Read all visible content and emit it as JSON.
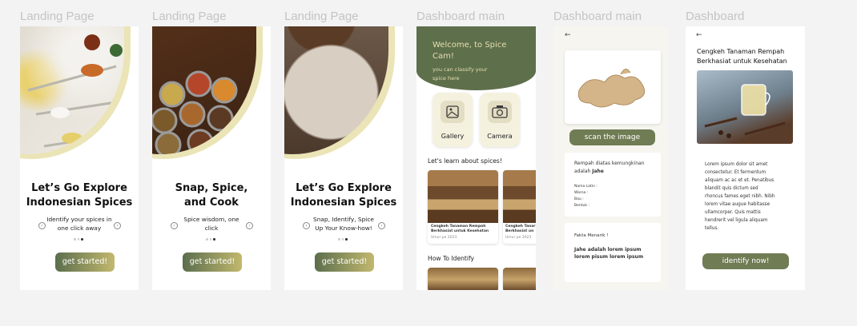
{
  "frame_labels": [
    "Landing Page",
    "Landing Page",
    "Landing Page",
    "Dashboard main",
    "Dashboard main",
    "Dashboard"
  ],
  "landing": [
    {
      "title_line1": "Let’s Go Explore",
      "title_line2": "Indonesian Spices",
      "subtitle_line1": "Identify your spices in",
      "subtitle_line2": "one click away",
      "button": "get started!"
    },
    {
      "title_line1": "Snap, Spice,",
      "title_line2": "and Cook",
      "subtitle_line1": "Spice wisdom, one",
      "subtitle_line2": "click",
      "button": "get started!"
    },
    {
      "title_line1": "Let’s Go Explore",
      "title_line2": "Indonesian Spices",
      "subtitle_line1": "Snap, Identify, Spice",
      "subtitle_line2": "Up Your Know-how!",
      "button": "get started!"
    }
  ],
  "dashboard": {
    "welcome_line1": "Welcome, to Spice",
    "welcome_line2": "Cam!",
    "sub_line1": "you can classify your",
    "sub_line2": "spice here",
    "gallery": "Gallery",
    "camera": "Camera",
    "learn_title": "Let's learn about spices!",
    "article_line1": "Cengkeh Tanaman Rempah",
    "article_line2": "Berkhasiat untuk Kesehatan",
    "article_line1b": "Cengkeh Tanar",
    "article_line2b": "Berkhasiat un",
    "article_date": "Umur pe 2023",
    "how_title": "How To Identify"
  },
  "scan": {
    "button": "scan the image",
    "result_line1": "Rempah diatas kemungkinan",
    "result_prefix": "adalah",
    "result_name": "Jahe",
    "fields": [
      "Nama Latin :",
      "Warna :",
      "Bau :",
      "Bentuk :"
    ],
    "fakta_title": "Fakta Menarik !",
    "fakta_line1": "Jahe adalah lorem ipsum",
    "fakta_line2": "lorem pisum lorem ipsum"
  },
  "detail": {
    "title_line1": "Cengkeh Tanaman Rempah",
    "title_line2": "Berkhasiat untuk Kesehatan",
    "body": [
      "Lorem ipsum dolor sit amet",
      "consectetur. Et fermentum",
      "aliquam ac ac et et. Penatibus",
      "blandit quis dictum sed",
      "rhoncus fames eget nibh. Nibh",
      "lorem vitae augue habitasse",
      "ullamcorper. Quis mattis",
      "hendrerit vel ligula aliquam",
      "tellus."
    ],
    "button": "identify now!"
  },
  "colors": {
    "olive": "#5e6f4b",
    "cream": "#ebe4b6",
    "button_olive": "#707c54",
    "background": "#f3f3f4"
  }
}
